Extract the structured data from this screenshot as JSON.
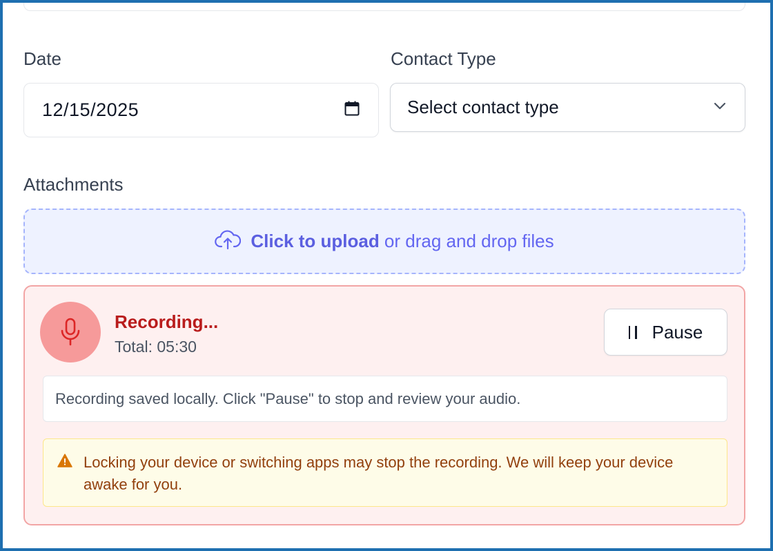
{
  "form": {
    "date_label": "Date",
    "date_value": "12/15/2025",
    "contact_type_label": "Contact Type",
    "contact_type_value": "Select contact type",
    "attachments_label": "Attachments"
  },
  "upload": {
    "action_text": "Click to upload",
    "rest_text": " or drag and drop files"
  },
  "recording": {
    "status": "Recording...",
    "total": "Total: 05:30",
    "pause_label": "Pause",
    "info_message": "Recording saved locally. Click \"Pause\" to stop and review your audio.",
    "warning_message": "Locking your device or switching apps may stop the recording. We will keep your device awake for you."
  },
  "colors": {
    "accent": "#6366f1",
    "recording": "#b91c1c",
    "warning": "#92400e",
    "frame": "#1e6fb0"
  },
  "icons": {
    "date": "calendar-icon",
    "select": "chevron-down-icon",
    "upload": "cloud-upload-icon",
    "recording": "microphone-icon",
    "pause": "pause-icon",
    "warning": "warning-icon"
  }
}
